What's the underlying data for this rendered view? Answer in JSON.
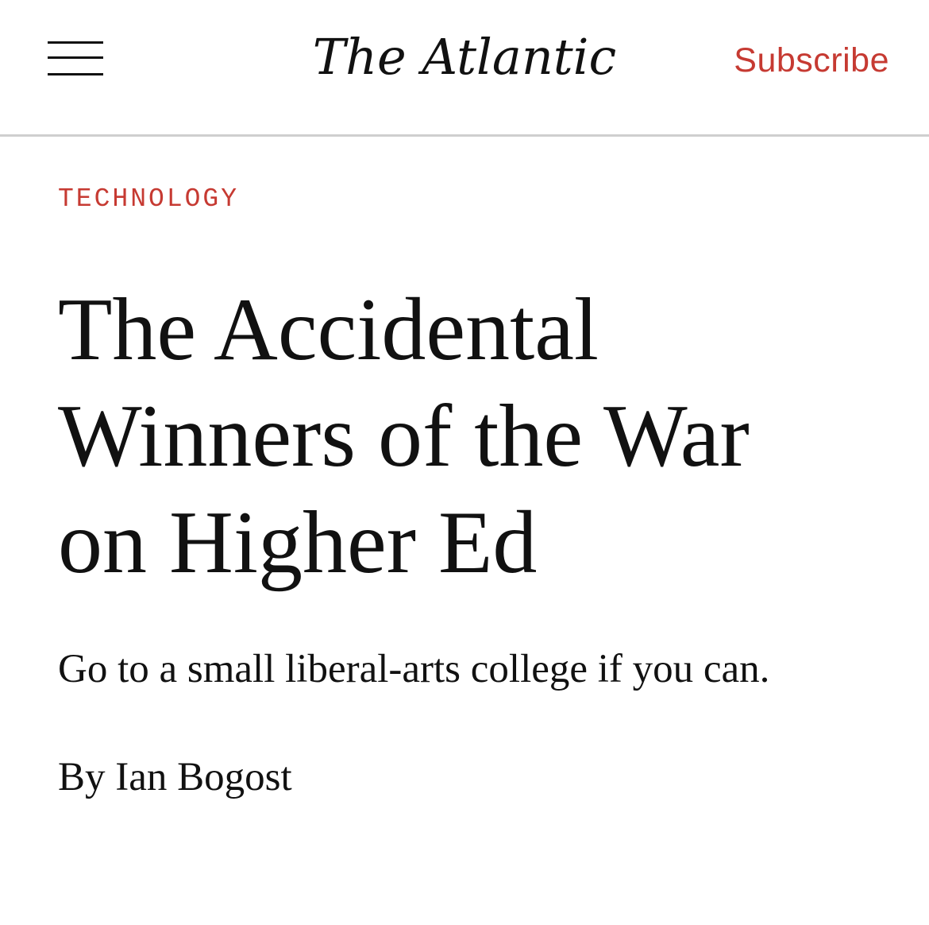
{
  "header": {
    "menu_icon": "hamburger-menu-icon",
    "logo_text": "The Atlantic",
    "subscribe_label": "Subscribe"
  },
  "article": {
    "section": "TECHNOLOGY",
    "headline_lines": [
      "The Accidental",
      "Winners of the War",
      "on Higher Ed"
    ],
    "dek": "Go to a small liberal-arts college if you can.",
    "byline_prefix": "By",
    "author": "Ian Bogost"
  },
  "colors": {
    "accent": "#c63a32",
    "text": "#111111",
    "divider": "#cfcfcf",
    "background": "#ffffff"
  }
}
